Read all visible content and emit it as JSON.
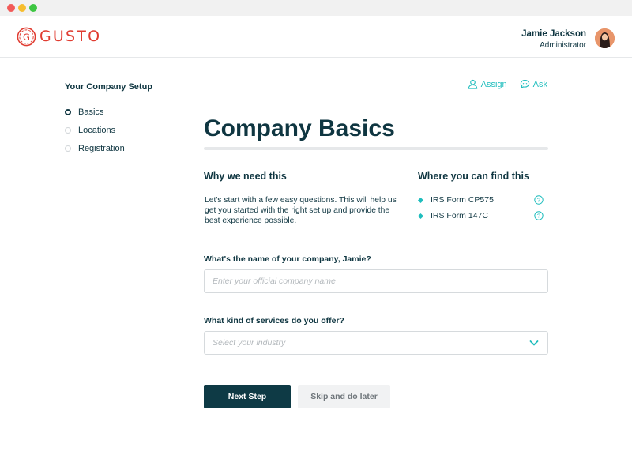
{
  "app": {
    "brand": "GUSTO",
    "colors": {
      "brand": "#e03c31",
      "accent": "#1fbdbd",
      "primary": "#0e3a45",
      "progress": "#f4b400"
    }
  },
  "header": {
    "user_name": "Jamie Jackson",
    "user_role": "Administrator",
    "avatar_icon": "user-avatar"
  },
  "sidebar": {
    "title": "Your Company Setup",
    "items": [
      {
        "label": "Basics",
        "active": true
      },
      {
        "label": "Locations",
        "active": false
      },
      {
        "label": "Registration",
        "active": false
      }
    ]
  },
  "actions": {
    "assign_label": "Assign",
    "assign_icon": "user-icon",
    "ask_label": "Ask",
    "ask_icon": "chat-bubble-icon"
  },
  "main": {
    "title": "Company Basics",
    "why": {
      "heading": "Why we need this",
      "text": "Let's start with a few easy questions. This will help us get you started with the right set up and provide the best experience possible."
    },
    "find": {
      "heading": "Where you can find this",
      "items": [
        {
          "label": "IRS Form CP575",
          "icon": "question-circle-icon"
        },
        {
          "label": "IRS Form 147C",
          "icon": "question-circle-icon"
        }
      ]
    },
    "company_field": {
      "label": "What's the name of your company, Jamie?",
      "placeholder": "Enter your official company name",
      "value": ""
    },
    "industry_field": {
      "label": "What kind of services do you offer?",
      "placeholder": "Select your industry",
      "icon": "chevron-down-icon"
    },
    "buttons": {
      "next": "Next Step",
      "skip": "Skip and do later"
    }
  }
}
